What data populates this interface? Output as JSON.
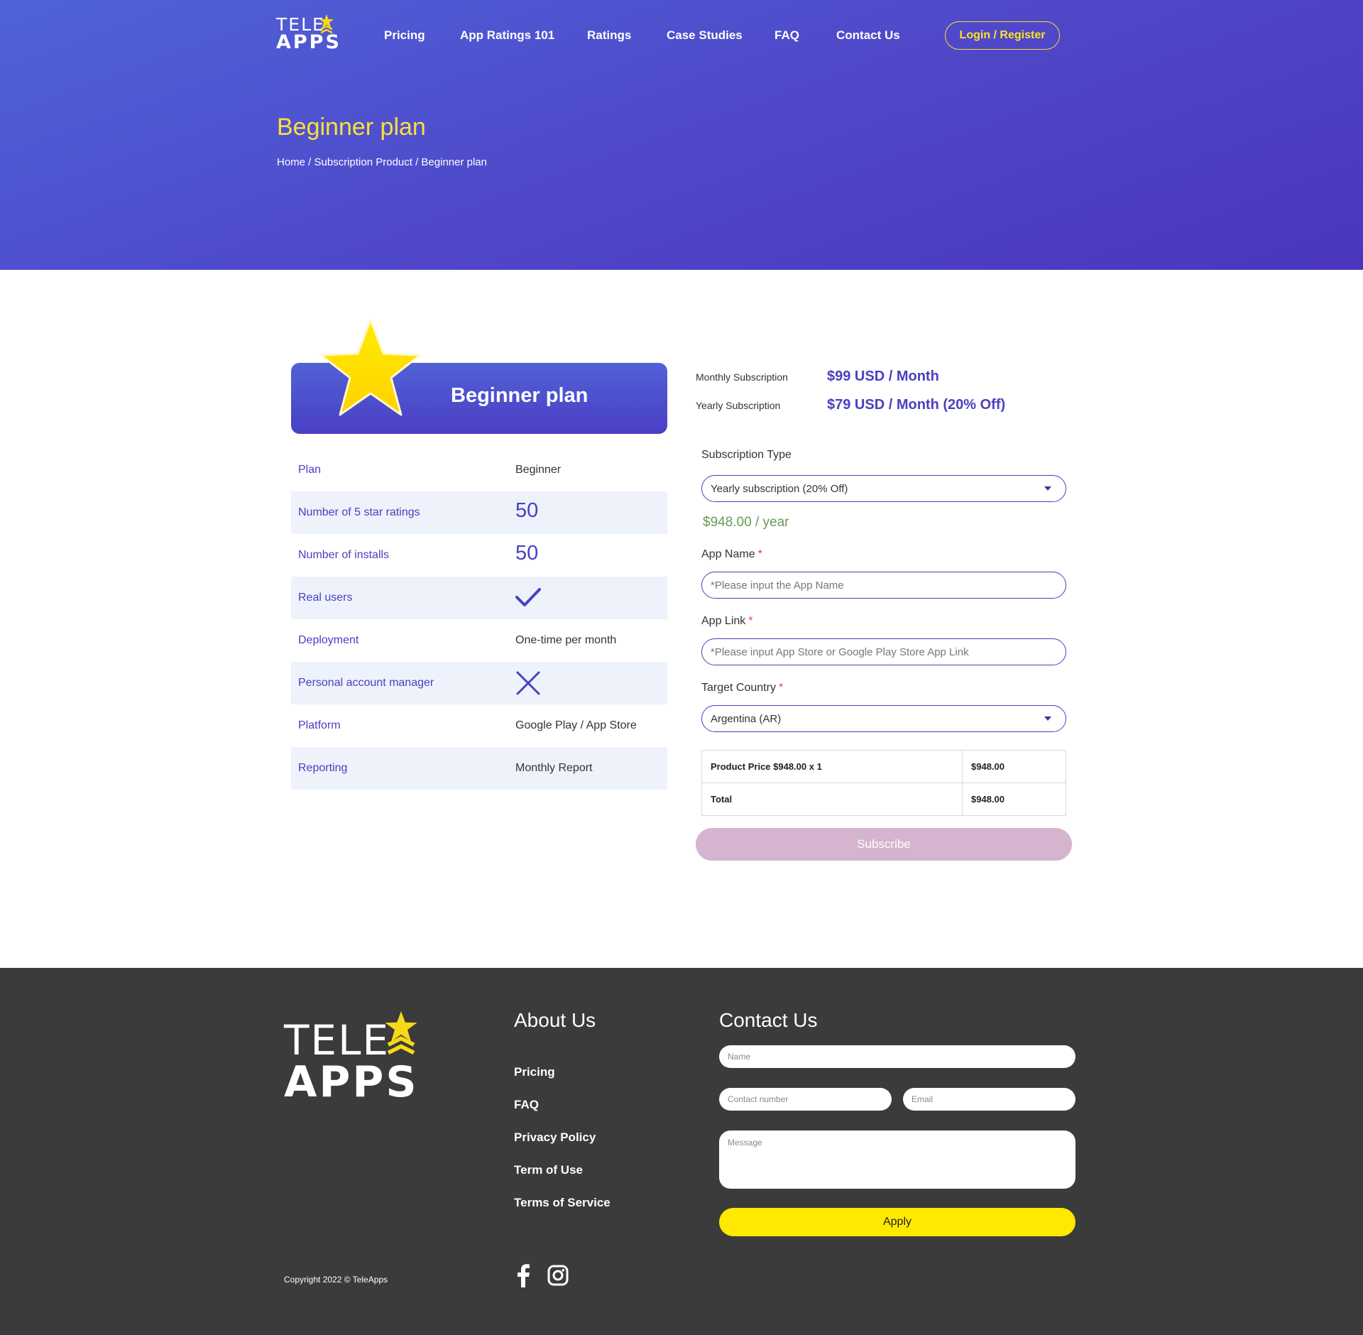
{
  "header": {
    "logo": {
      "line1": "TELE",
      "line2": "APPS"
    },
    "nav": [
      "Pricing",
      "App Ratings 101",
      "Ratings",
      "Case Studies",
      "FAQ",
      "Contact Us"
    ],
    "login_label": "Login / Register",
    "page_title": "Beginner plan",
    "breadcrumb": "Home / Subscription Product / Beginner plan"
  },
  "plan": {
    "title": "Beginner plan",
    "features": [
      {
        "label": "Plan",
        "value": "Beginner"
      },
      {
        "label": "Number of 5 star ratings",
        "value": "50"
      },
      {
        "label": "Number of installs",
        "value": "50"
      },
      {
        "label": "Real users",
        "icon": "check-icon"
      },
      {
        "label": "Deployment",
        "value": "One-time per month"
      },
      {
        "label": "Personal account manager",
        "icon": "cross-icon"
      },
      {
        "label": "Platform",
        "value": "Google Play / App Store"
      },
      {
        "label": "Reporting",
        "value": "Monthly Report"
      }
    ]
  },
  "pricing": {
    "monthly_label": "Monthly Subscription",
    "monthly_value": "$99 USD / Month",
    "yearly_label": "Yearly Subscription",
    "yearly_value": "$79 USD / Month (20% Off)"
  },
  "form": {
    "subscription_type_label": "Subscription Type",
    "subscription_type_value": "Yearly subscription (20% Off)",
    "year_price": "$948.00 / year",
    "app_name_label": "App Name",
    "app_name_placeholder": "*Please input the App Name",
    "app_link_label": "App Link",
    "app_link_placeholder": "*Please input App Store or Google Play Store App Link",
    "target_country_label": "Target Country",
    "target_country_value": "Argentina (AR)",
    "required_mark": "*",
    "summary": [
      {
        "label": "Product Price $948.00 x 1",
        "amount": "$948.00"
      },
      {
        "label": "Total",
        "amount": "$948.00"
      }
    ],
    "subscribe_label": "Subscribe"
  },
  "footer": {
    "logo": {
      "line1": "TELE",
      "line2": "APPS"
    },
    "about_heading": "About Us",
    "links": [
      "Pricing",
      "FAQ",
      "Privacy Policy",
      "Term of Use",
      "Terms of Service"
    ],
    "contact_heading": "Contact Us",
    "name_placeholder": "Name",
    "contact_placeholder": "Contact number",
    "email_placeholder": "Email",
    "message_placeholder": "Message",
    "apply_label": "Apply",
    "copyright": "Copyright 2022 © TeleApps",
    "social_icons": [
      "facebook-icon",
      "instagram-icon"
    ]
  },
  "colors": {
    "hero_gradient_start": "#4f63d8",
    "hero_gradient_end": "#4a36bd",
    "accent_purple": "#4a3fbf",
    "title_yellow": "#ffdf3d",
    "price_green": "#6a9a55",
    "subscribe_pink": "#d5b4cf",
    "footer_bg": "#3b3b3b",
    "apply_yellow": "#ffe900"
  }
}
